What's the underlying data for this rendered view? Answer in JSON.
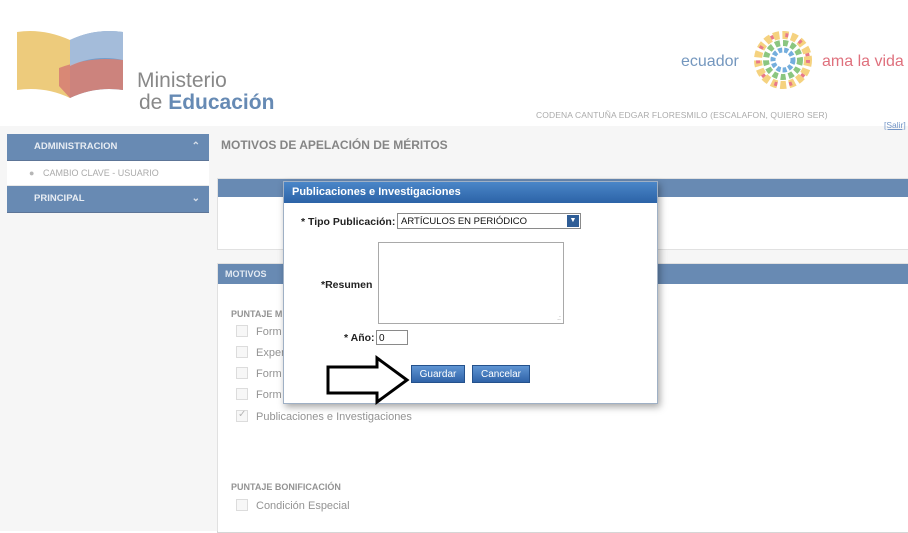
{
  "header": {
    "logo_line1": "Ministerio",
    "logo_line2_prefix": "de ",
    "logo_line2_bold": "Educación",
    "brand_left": "ecuador",
    "brand_right": "ama la vida",
    "user_text": "CODENA CANTUÑA EDGAR FLORESMILO (ESCALAFON, QUIERO SER)",
    "logout_label": "[Salir]"
  },
  "sidebar": {
    "sections": [
      {
        "label": "ADMINISTRACION",
        "icon": "chevron-up-icon",
        "items": [
          {
            "label": "CAMBIO CLAVE - USUARIO"
          }
        ]
      },
      {
        "label": "PRINCIPAL",
        "icon": "chevron-down-icon",
        "items": []
      }
    ]
  },
  "main": {
    "title": "MOTIVOS DE APELACIÓN DE MÉRITOS",
    "motivos_panel_title": "MOTIVOS",
    "puntaje_merito_label": "PUNTAJE M",
    "checkboxes": [
      {
        "label": "Form",
        "checked": false
      },
      {
        "label": "Exper",
        "checked": false
      },
      {
        "label": "Form",
        "checked": false
      },
      {
        "label": "Form",
        "checked": false
      },
      {
        "label": "Publicaciones e Investigaciones",
        "checked": true
      }
    ],
    "bonificacion_label": "PUNTAJE BONIFICACIÓN",
    "bonificacion_items": [
      {
        "label": "Condición Especial",
        "checked": false
      }
    ]
  },
  "dialog": {
    "title": "Publicaciones e Investigaciones",
    "tipo_label": "* Tipo Publicación:",
    "tipo_value": "ARTÍCULOS EN PERIÓDICO",
    "resumen_label": "*Resumen",
    "resumen_value": "",
    "anio_label": "* Año:",
    "anio_value": "0",
    "save_label": "Guardar",
    "cancel_label": "Cancelar"
  },
  "colors": {
    "header_blue": "#2f5d96",
    "brand_red": "#d33a4b",
    "brand_blue": "#3f6fa6"
  }
}
